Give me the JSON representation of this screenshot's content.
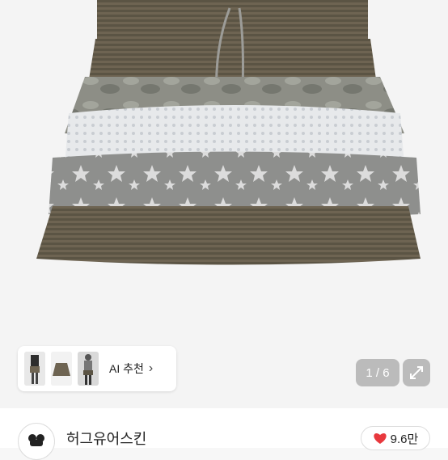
{
  "product": {
    "image_name": "striped ruffle mini skirt with camo, lace and star tiers",
    "thumbnails": [
      "outfit-photo",
      "skirt-photo",
      "model-photo"
    ]
  },
  "ai_recommend": {
    "label": "AI 추천",
    "icon": "chevron-right-icon"
  },
  "gallery": {
    "counter": "1 / 6",
    "expand_icon": "expand-icon"
  },
  "shop": {
    "name": "허그유어스킨",
    "avatar_icon": "shop-logo-icon"
  },
  "like": {
    "count": "9.6만",
    "icon": "heart-icon",
    "color": "#e8383d"
  },
  "colors": {
    "skirt_brown": "#6e6452",
    "ruffle_gray": "#8e8f8d",
    "lace_white": "#e6e8ea"
  }
}
